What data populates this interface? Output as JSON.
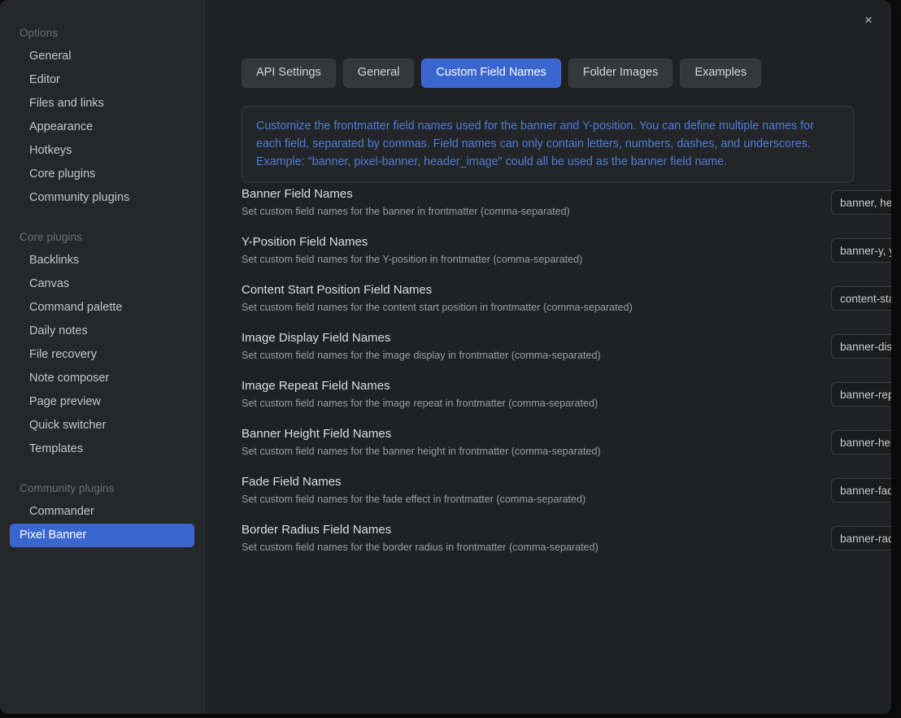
{
  "window": {
    "close_label": "×"
  },
  "sidebar": {
    "sections": [
      {
        "heading": "Options",
        "items": [
          {
            "label": "General",
            "active": false
          },
          {
            "label": "Editor",
            "active": false
          },
          {
            "label": "Files and links",
            "active": false
          },
          {
            "label": "Appearance",
            "active": false
          },
          {
            "label": "Hotkeys",
            "active": false
          },
          {
            "label": "Core plugins",
            "active": false
          },
          {
            "label": "Community plugins",
            "active": false
          }
        ]
      },
      {
        "heading": "Core plugins",
        "items": [
          {
            "label": "Backlinks",
            "active": false
          },
          {
            "label": "Canvas",
            "active": false
          },
          {
            "label": "Command palette",
            "active": false
          },
          {
            "label": "Daily notes",
            "active": false
          },
          {
            "label": "File recovery",
            "active": false
          },
          {
            "label": "Note composer",
            "active": false
          },
          {
            "label": "Page preview",
            "active": false
          },
          {
            "label": "Quick switcher",
            "active": false
          },
          {
            "label": "Templates",
            "active": false
          }
        ]
      },
      {
        "heading": "Community plugins",
        "items": [
          {
            "label": "Commander",
            "active": false
          },
          {
            "label": "Pixel Banner",
            "active": true
          }
        ]
      }
    ]
  },
  "tabs": [
    {
      "label": "API Settings",
      "active": false
    },
    {
      "label": "General",
      "active": false
    },
    {
      "label": "Custom Field Names",
      "active": true
    },
    {
      "label": "Folder Images",
      "active": false
    },
    {
      "label": "Examples",
      "active": false
    }
  ],
  "info_box": {
    "text": "Customize the frontmatter field names used for the banner and Y-position. You can define multiple names for each field, separated by commas. Field names can only contain letters, numbers, dashes, and underscores. Example: \"banner, pixel-banner, header_image\" could all be used as the banner field name."
  },
  "settings": [
    {
      "title": "Banner Field Names",
      "description": "Set custom field names for the banner in frontmatter (comma-separated)",
      "value": "banner, header-image"
    },
    {
      "title": "Y-Position Field Names",
      "description": "Set custom field names for the Y-position in frontmatter (comma-separated)",
      "value": "banner-y, y"
    },
    {
      "title": "Content Start Position Field Names",
      "description": "Set custom field names for the content start position in frontmatter (comma-separated)",
      "value": "content-start, start"
    },
    {
      "title": "Image Display Field Names",
      "description": "Set custom field names for the image display in frontmatter (comma-separated)",
      "value": "banner-display"
    },
    {
      "title": "Image Repeat Field Names",
      "description": "Set custom field names for the image repeat in frontmatter (comma-separated)",
      "value": "banner-repeat"
    },
    {
      "title": "Banner Height Field Names",
      "description": "Set custom field names for the banner height in frontmatter (comma-separated)",
      "value": "banner-height"
    },
    {
      "title": "Fade Field Names",
      "description": "Set custom field names for the fade effect in frontmatter (comma-separated)",
      "value": "banner-fade"
    },
    {
      "title": "Border Radius Field Names",
      "description": "Set custom field names for the border radius in frontmatter (comma-separated)",
      "value": "banner-radius"
    }
  ],
  "icons": {
    "reset": "reset-icon",
    "close": "close-icon"
  },
  "colors": {
    "accent": "#3a66cf",
    "info_text": "#4e7fd6",
    "modal_bg": "#202124",
    "sidebar_bg": "#262729"
  }
}
